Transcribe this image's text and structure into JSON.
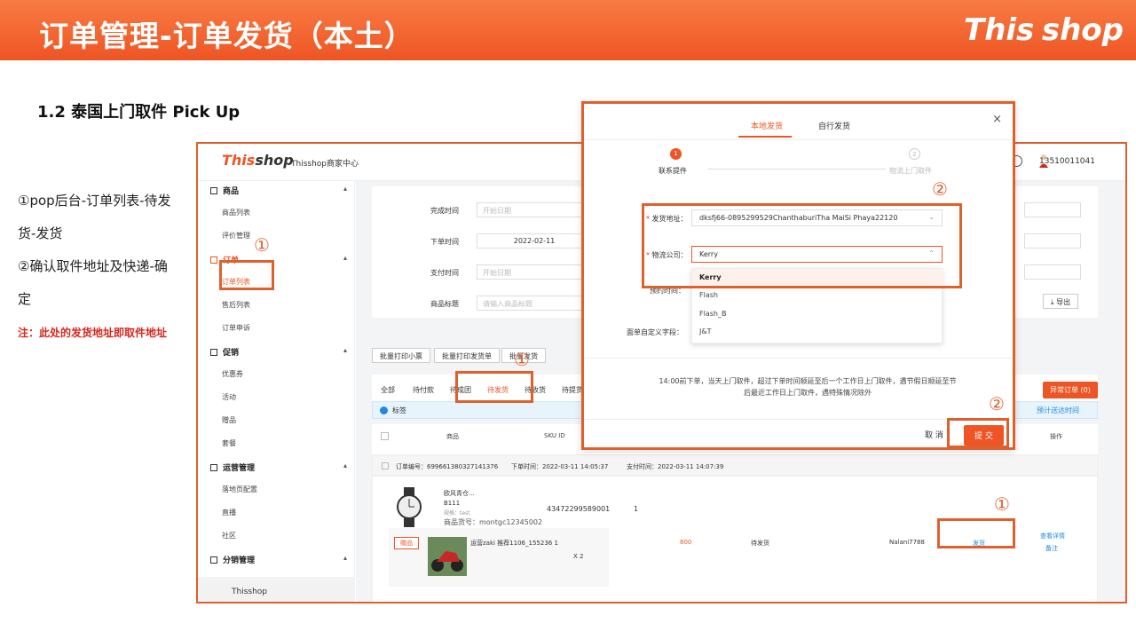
{
  "header": {
    "title": "订单管理-订单发货（本土）",
    "brand_left": "This",
    "brand_right": "shop"
  },
  "section_title": "1.2 泰国上门取件 Pick Up",
  "steps": {
    "line1": "①pop后台-订单列表-待发",
    "line2": "货-发货",
    "line3": "②确认取件地址及快递-确",
    "line4": "定"
  },
  "note": "注：此处的发货地址即取件地址",
  "app": {
    "logo_left": "This",
    "logo_right": "shop",
    "center_name": "Thisshop商家中心",
    "user_phone": "13510011041",
    "sidebar": {
      "goods": "商品",
      "goods_list": "商品列表",
      "review_mgmt": "评价管理",
      "orders": "订单",
      "order_list": "订单列表",
      "after_sale": "售后列表",
      "order_apply": "订单申诉",
      "promo": "促销",
      "coupon": "优惠券",
      "activity": "活动",
      "gift": "赠品",
      "bundle": "套餐",
      "ops": "运营管理",
      "landing": "落地页配置",
      "live": "直播",
      "community": "社区",
      "distribution": "分销管理",
      "footer": "Thisshop"
    },
    "filters": {
      "complete_time": "完成时间",
      "complete_ph": "开始日期",
      "order_time": "下单时间",
      "order_date": "2022-02-11",
      "pay_time": "支付时间",
      "pay_ph": "开始日期",
      "goods_title": "商品标题",
      "goods_ph": "请输入商品标题",
      "export": "导出"
    },
    "actions": {
      "print_ticket": "批量打印小票",
      "print_invoice": "批量打印发货单",
      "batch_ship": "批量发货"
    },
    "tabs": [
      "全部",
      "待付款",
      "待成团",
      "待发货",
      "待收货",
      "待提货"
    ],
    "tab_active_index": 3,
    "abnormal_btn": "异常订单 (0)",
    "info_label": "标签",
    "estimate": "预计送达时间",
    "table_headers": {
      "goods": "商品",
      "sku": "SKU ID",
      "action": "操作"
    },
    "order": {
      "no_label": "订单编号：",
      "no": "699661380327141376",
      "order_time": "下单时间：2022-03-11 14:05:37",
      "pay_time": "支付时间：2022-03-11 14:07:39",
      "item_name": "欧风青仓...",
      "item_code": "B111",
      "item_spec": "规格：test",
      "item_no": "商品货号：montgc12345002",
      "sku_id": "43472299589001",
      "qty": "1",
      "gift_tag": "赠品",
      "gift_desc": "运营zaki 推荐1106_155236 1",
      "gift_qty": "X 2",
      "amount": "800",
      "status": "待发货",
      "buyer": "Nalani7788",
      "ship_link": "发货",
      "detail_link": "查看详情",
      "remark_link": "备注"
    }
  },
  "modal": {
    "tab_platform": "本地发货",
    "tab_self": "自行发货",
    "close": "×",
    "step1_num": "1",
    "step1": "联系提件",
    "step2_num": "2",
    "step2": "物流上门取件",
    "ship_addr_label": "发货地址：",
    "ship_addr_value": "dksfj66-0895299529ChanthaburiTha MaiSi Phaya22120",
    "logistics_label": "物流公司：",
    "logistics_value": "Kerry",
    "pickup_label": "预约时间：",
    "custom_label": "面单自定义字段：",
    "options": [
      "Kerry",
      "Flash",
      "Flash_B",
      "J&T"
    ],
    "tip": "14:00前下单，当天上门取件，超过下单时间顺延至后一个工作日上门取件，遇节假日顺延至节后最近工作日上门取件，遇特殊情况除外",
    "cancel": "取 消",
    "submit": "提 交"
  },
  "markers": {
    "c1": "①",
    "c2": "②"
  },
  "colors": {
    "accent": "#ee5524",
    "highlight": "#e0602d",
    "note": "#d9261c"
  }
}
